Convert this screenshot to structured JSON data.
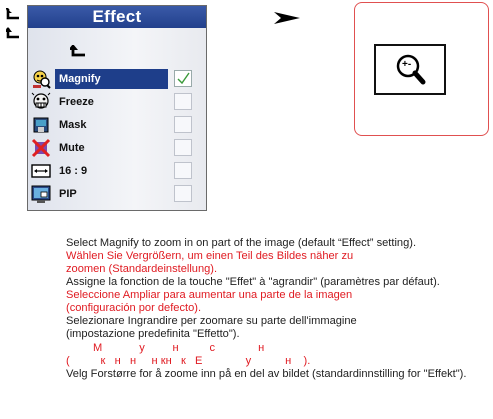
{
  "menu": {
    "title": "Effect",
    "items": [
      {
        "label": "Magnify",
        "icon": "magnify-icon",
        "selected": true,
        "checked": true
      },
      {
        "label": "Freeze",
        "icon": "freeze-icon",
        "selected": false,
        "checked": false
      },
      {
        "label": "Mask",
        "icon": "mask-icon",
        "selected": false,
        "checked": false
      },
      {
        "label": "Mute",
        "icon": "mute-icon",
        "selected": false,
        "checked": false
      },
      {
        "label": "16 : 9",
        "icon": "aspect-ratio-icon",
        "selected": false,
        "checked": false
      },
      {
        "label": "PIP",
        "icon": "pip-icon",
        "selected": false,
        "checked": false
      }
    ],
    "title_color": "#22408c",
    "selection_color": "#1e3e8a"
  },
  "preview": {
    "icon": "zoom-in-icon",
    "symbol": "+-",
    "border_color": "#e05050"
  },
  "instructions": [
    {
      "text": "Select Magnify to zoom in on part of the image (default “Effect” setting).",
      "color": "black"
    },
    {
      "text": "Wählen Sie Vergrößern, um einen Teil des Bildes näher zu",
      "color": "red"
    },
    {
      "text": "zoomen (Standardeinstellung).",
      "color": "red"
    },
    {
      "text": "Assigne la fonction de la touche \"Effet\" à \"agrandir\" (paramètres par défaut).",
      "color": "black"
    },
    {
      "text": "Seleccione Ampliar para aumentar una parte de la imagen",
      "color": "red"
    },
    {
      "text": "(configuración por defecto).",
      "color": "red"
    },
    {
      "text": "Selezionare Ingrandire per zoomare su parte dell'immagine",
      "color": "black"
    },
    {
      "text": "(impostazione predefinita \"Effetto\").",
      "color": "black"
    },
    {
      "text": "М            у         н          с              н",
      "color": "red"
    },
    {
      "text": "(          к   н   н     н кн   к   Е              у           н    ).",
      "color": "red"
    },
    {
      "text": "Velg Forstørre for å zoome inn på en del av bildet (standardinnstilling for \"Effekt\").",
      "color": "black"
    }
  ]
}
